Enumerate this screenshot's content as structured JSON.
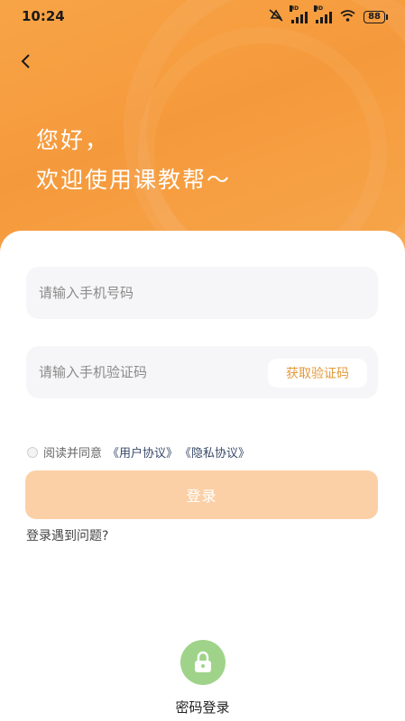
{
  "status_bar": {
    "time": "10:24",
    "signal_label_1": "HD",
    "signal_label_2": "HD",
    "battery": "88"
  },
  "header": {
    "greeting_line1": "您好，",
    "greeting_line2": "欢迎使用课教帮～",
    "background_color": "#f59a3c"
  },
  "form": {
    "phone_placeholder": "请输入手机号码",
    "code_placeholder": "请输入手机验证码",
    "get_code_label": "获取验证码",
    "agree_text": "阅读并同意",
    "user_agreement": "《用户协议》",
    "privacy_agreement": "《隐私协议》",
    "login_label": "登录",
    "help_text": "登录遇到问题?"
  },
  "alt_login": {
    "label": "密码登录",
    "icon": "lock-icon"
  },
  "colors": {
    "accent": "#f59a3c",
    "login_button": "#fbd0a6",
    "code_text": "#e39a3b",
    "lock_bg": "#9fd38a"
  }
}
